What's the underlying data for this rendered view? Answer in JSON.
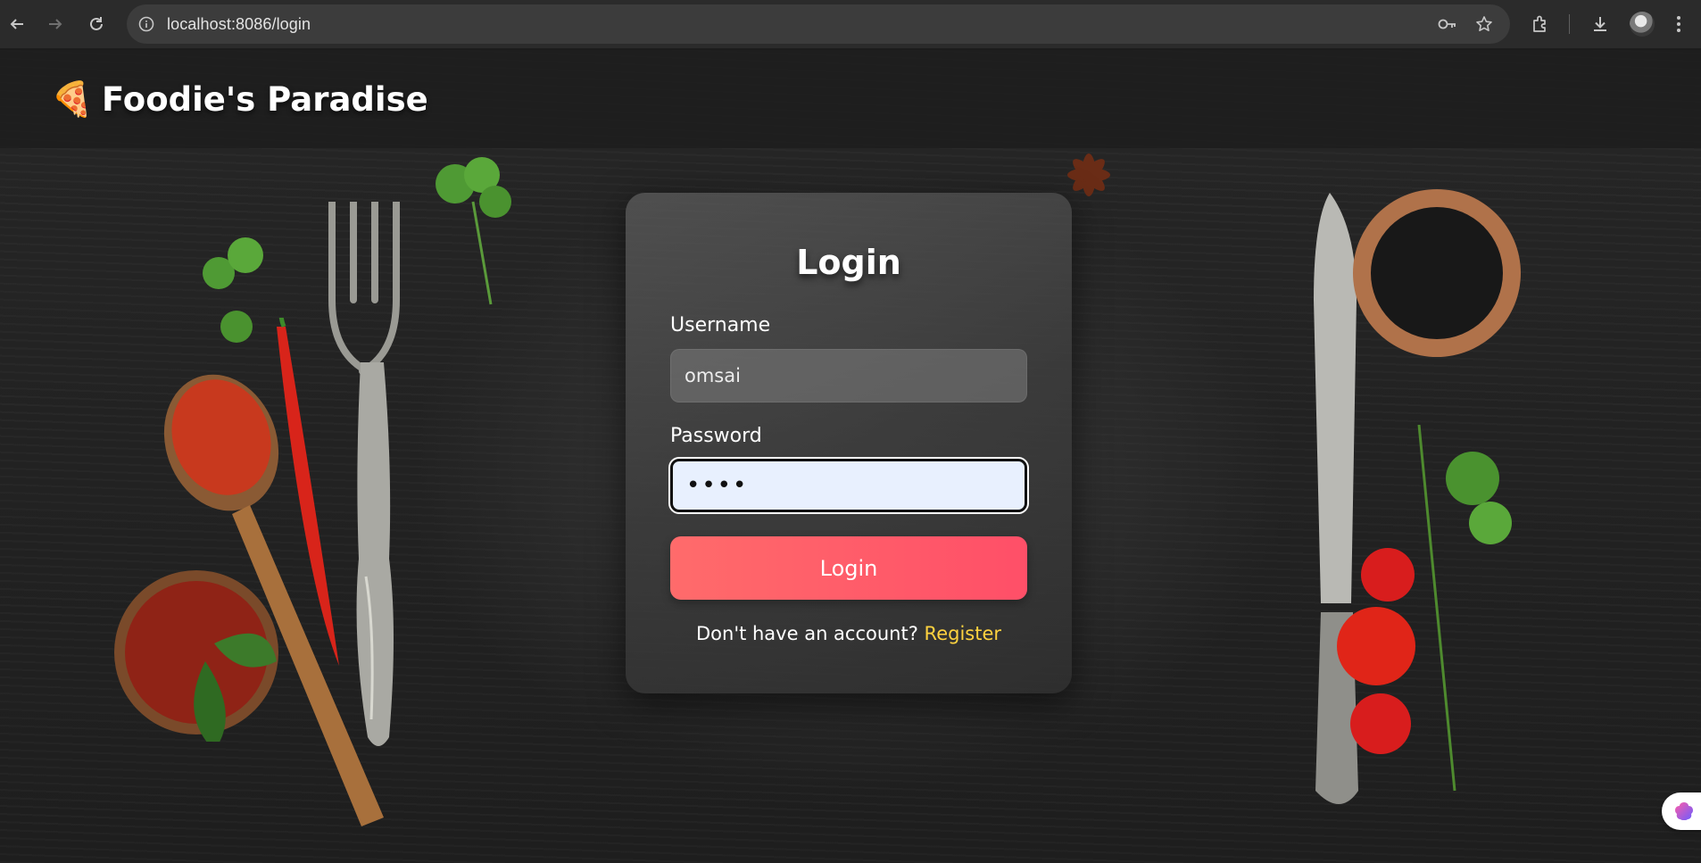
{
  "browser": {
    "url": "localhost:8086/login",
    "icons": [
      "back-arrow-icon",
      "forward-arrow-icon",
      "reload-icon",
      "site-info-icon",
      "password-key-icon",
      "bookmark-star-icon",
      "extensions-icon",
      "download-icon",
      "profile-avatar",
      "more-menu-icon"
    ]
  },
  "header": {
    "brand_icon": "🍕",
    "brand_name": "Foodie's Paradise"
  },
  "login": {
    "title": "Login",
    "username_label": "Username",
    "username_value": "omsai",
    "password_label": "Password",
    "password_value": "••••",
    "submit_label": "Login",
    "register_prompt": "Don't have an account?",
    "register_link": "Register"
  },
  "colors": {
    "accent": "#ff5a65",
    "link": "#ffd23f",
    "header_bg": "#1e1e1e",
    "autofill_bg": "#e8f0fe"
  }
}
